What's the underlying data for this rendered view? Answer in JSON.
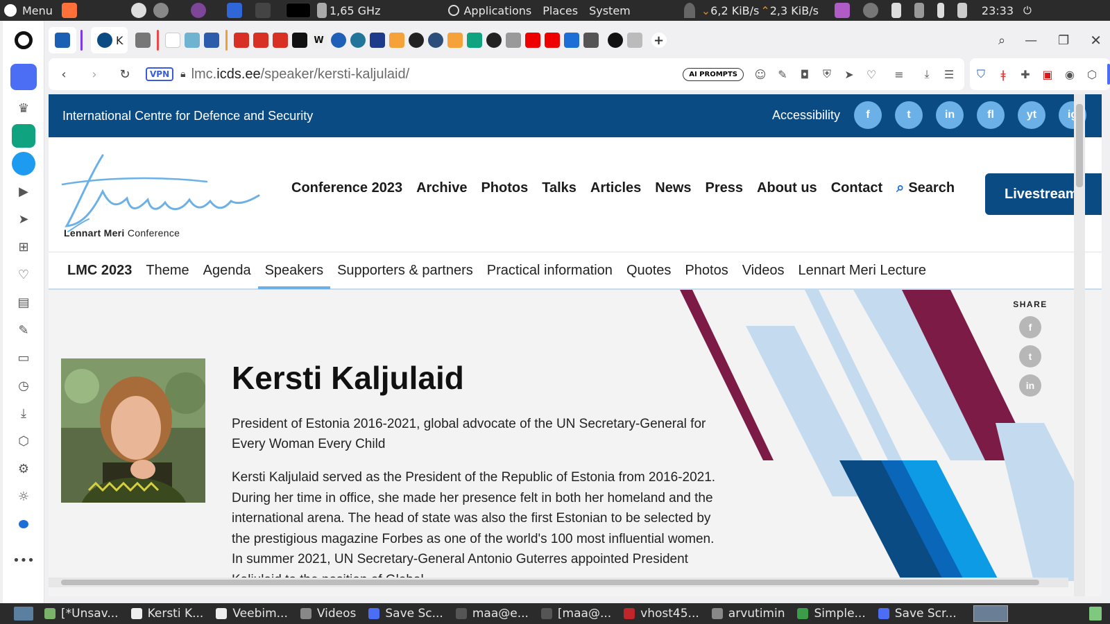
{
  "os_top": {
    "menu_label": "Menu",
    "cpu_freq": "1,65 GHz",
    "applications": "Applications",
    "places": "Places",
    "system": "System",
    "net_down": "6,2 KiB/s",
    "net_up": "2,3 KiB/s",
    "clock": "23:33"
  },
  "tabs": [
    {
      "icon": "shield-v-icon",
      "color": "#1a5fb4"
    },
    {
      "icon": "gmail-icon",
      "color": "#d93025"
    },
    {
      "icon": "pdf-icon",
      "color": "#d71b1b"
    },
    {
      "icon": "chatgpt-icon",
      "color": "#10a37f"
    },
    {
      "icon": "web-icon",
      "color": "#6c4ad4"
    },
    {
      "icon": "github-icon",
      "color": "#222"
    },
    {
      "icon": "wikipedia-icon",
      "color": "#555"
    },
    {
      "icon": "wordpress-icon",
      "color": "#21759b"
    },
    {
      "icon": "youtube-icon",
      "color": "#e00"
    }
  ],
  "active_tab": {
    "label": "K"
  },
  "address": {
    "vpn": "VPN",
    "url_host": "lmc.",
    "url_domain": "icds.ee",
    "url_path": "/speaker/kersti-kaljulaid/",
    "ai_prompts": "AI PROMPTS"
  },
  "site": {
    "org": "International Centre for Defence and Security",
    "accessibility": "Accessibility",
    "social": [
      "f",
      "t",
      "in",
      "fl",
      "yt",
      "ig"
    ],
    "logo_caption_bold": "Lennart Meri",
    "logo_caption": "Conference",
    "main_nav": [
      "Conference 2023",
      "Archive",
      "Photos",
      "Talks",
      "Articles",
      "News",
      "Press",
      "About us",
      "Contact"
    ],
    "search": "Search",
    "livestream": "Livestream",
    "sub_nav": [
      "LMC 2023",
      "Theme",
      "Agenda",
      "Speakers",
      "Supporters & partners",
      "Practical information",
      "Quotes",
      "Photos",
      "Videos",
      "Lennart Meri Lecture"
    ],
    "active_sub_nav": "Speakers",
    "share_label": "SHARE",
    "speaker": {
      "name": "Kersti Kaljulaid",
      "role": "President of Estonia 2016-2021, global advocate of the UN Secretary-General for Every Woman Every Child",
      "bio": "Kersti Kaljulaid served as the President of the Republic of Estonia from 2016-2021. During her time in office, she made her presence felt in both her homeland and the international arena. The head of state was also the first Estonian to be selected by the prestigious magazine Forbes as one of the world's 100 most influential women. In summer 2021, UN Secretary-General Antonio Guterres appointed President Kaljulaid to the position of Global"
    }
  },
  "taskbar": [
    {
      "label": "[*Unsav...",
      "icon": "editor-icon"
    },
    {
      "label": "Kersti K...",
      "icon": "opera-icon"
    },
    {
      "label": "Veebim...",
      "icon": "opera-icon"
    },
    {
      "label": "Videos",
      "icon": "folder-icon"
    },
    {
      "label": "Save Sc...",
      "icon": "screenshot-icon"
    },
    {
      "label": "maa@e...",
      "icon": "terminal-icon"
    },
    {
      "label": "[maa@...",
      "icon": "terminal-icon"
    },
    {
      "label": "vhost45...",
      "icon": "filezilla-icon"
    },
    {
      "label": "arvutimin",
      "icon": "folder-icon"
    },
    {
      "label": "Simple...",
      "icon": "app-icon"
    },
    {
      "label": "Save Scr...",
      "icon": "screenshot-icon"
    }
  ]
}
